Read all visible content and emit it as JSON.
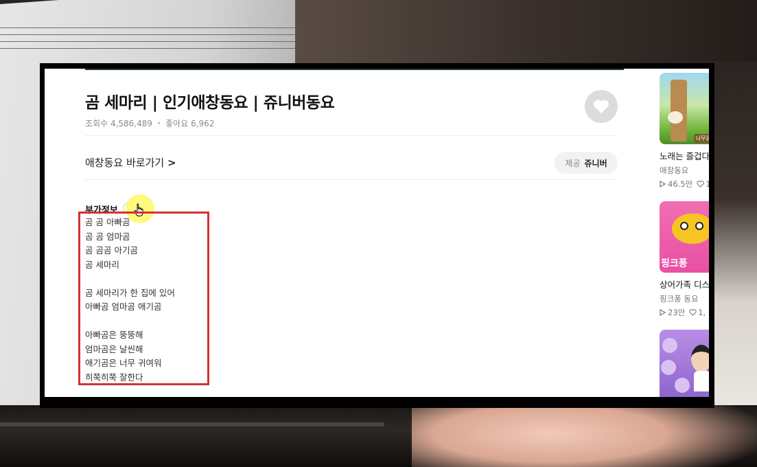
{
  "video": {
    "title": "곰 세마리 | 인기애창동요 | 쥬니버동요",
    "views_label": "조회수",
    "views": "4,586,489",
    "likes_label": "좋아요",
    "likes": "6,962"
  },
  "links": {
    "goto_label": "애창동요 바로가기",
    "goto_arrow": ">"
  },
  "provider": {
    "label": "제공",
    "name": "쥬니버"
  },
  "extra_info": {
    "title": "부가정보",
    "lyrics": [
      "곰 곰 아빠곰",
      "곰 곰 엄마곰",
      "곰 곰곰 아기곰",
      "곰 세마리",
      "",
      "곰 세마리가 한 집에 있어",
      "아빠곰 엄마곰 애기곰",
      "",
      "아빠곰은 뚱뚱해",
      "엄마곰은 날씬해",
      "애기곰은 너무 귀여워",
      "히쭉히쭉 잘한다"
    ]
  },
  "sidebar": {
    "items": [
      {
        "title": "노래는 즐겁다",
        "category": "애창동요",
        "plays": "46.5만",
        "likes": "1",
        "thumb_tag": "나무동"
      },
      {
        "title": "상어가족 디스",
        "category": "핑크퐁 동요",
        "plays": "23만",
        "likes": "1,",
        "thumb_text": "핑크퐁"
      },
      {
        "title": "",
        "category": "",
        "plays": "",
        "likes": ""
      }
    ]
  },
  "colors": {
    "highlight_border": "#d23232",
    "cursor_highlight": "#fff750",
    "top_accent": "#1f3d35"
  },
  "icons": [
    "heart-icon",
    "chevron-right-icon",
    "expand-chevron-icon",
    "hand-cursor-icon",
    "play-icon"
  ]
}
